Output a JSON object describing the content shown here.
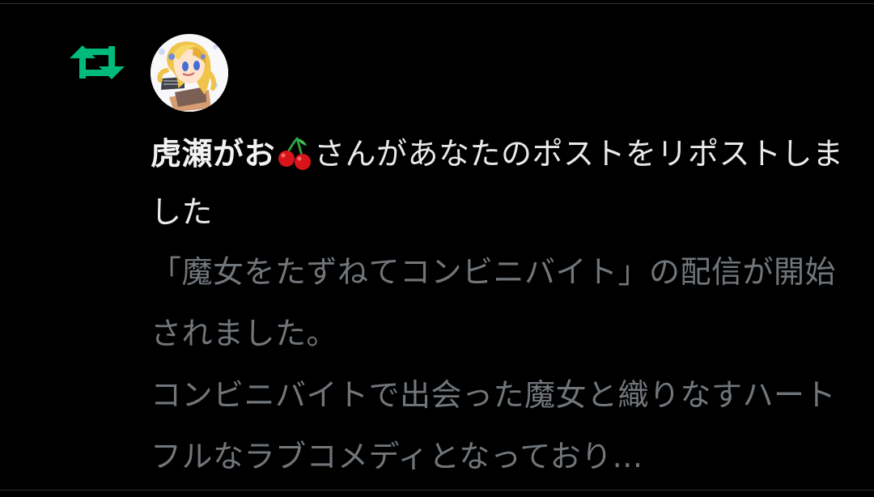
{
  "notification": {
    "type_icon": "repost-icon",
    "avatar_icon": "anime-avatar",
    "username": "虎瀬がお",
    "username_emoji": "cherry-emoji",
    "action_text": "さんがあなたのポストをリポストしました",
    "post_preview": "「魔女をたずねてコンビニバイト」の配信が開始されました。\nコンビニバイトで出会った魔女と織りなすハートフルなラブコメディとなっており..."
  },
  "colors": {
    "background": "#000000",
    "repost_icon": "#00ba7c",
    "primary_text": "#e7e9ea",
    "secondary_text": "#71767b",
    "divider": "#2f3336"
  }
}
